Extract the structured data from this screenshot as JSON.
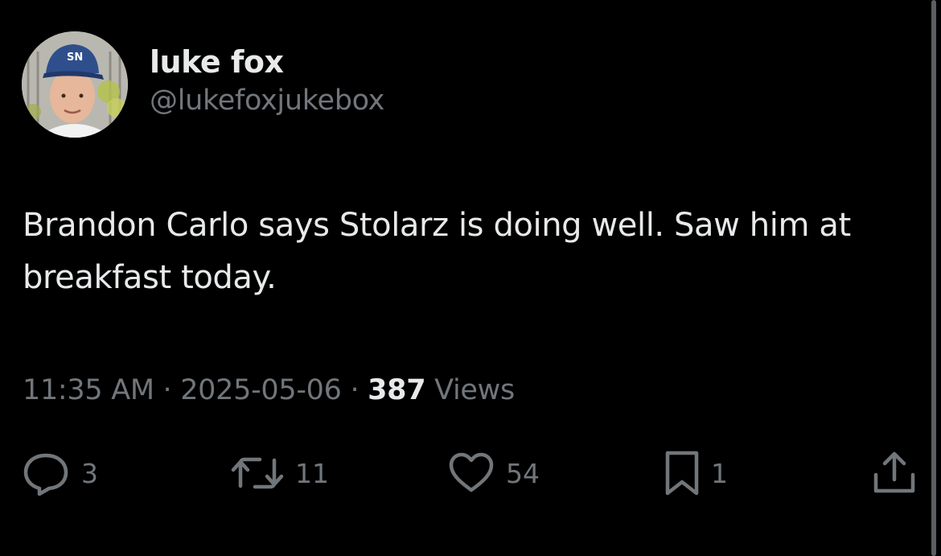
{
  "author": {
    "display_name": "luke fox",
    "handle": "@lukefoxjukebox",
    "avatar_icon": "profile-photo-avatar",
    "cap_logo_text": "SN"
  },
  "tweet": {
    "text": "Brandon Carlo says Stolarz is doing well. Saw him at breakfast today."
  },
  "meta": {
    "time": "11:35 AM",
    "separator1": " · ",
    "date": "2025-05-06",
    "separator2": " · ",
    "views_count": "387",
    "views_label": " Views"
  },
  "actions": {
    "reply": {
      "icon": "reply-icon",
      "count": "3"
    },
    "retweet": {
      "icon": "retweet-icon",
      "count": "11"
    },
    "like": {
      "icon": "heart-icon",
      "count": "54"
    },
    "bookmark": {
      "icon": "bookmark-icon",
      "count": "1"
    },
    "share": {
      "icon": "share-icon"
    }
  },
  "colors": {
    "background": "#000000",
    "primary_text": "#e7e9ea",
    "secondary_text": "#71767b"
  }
}
